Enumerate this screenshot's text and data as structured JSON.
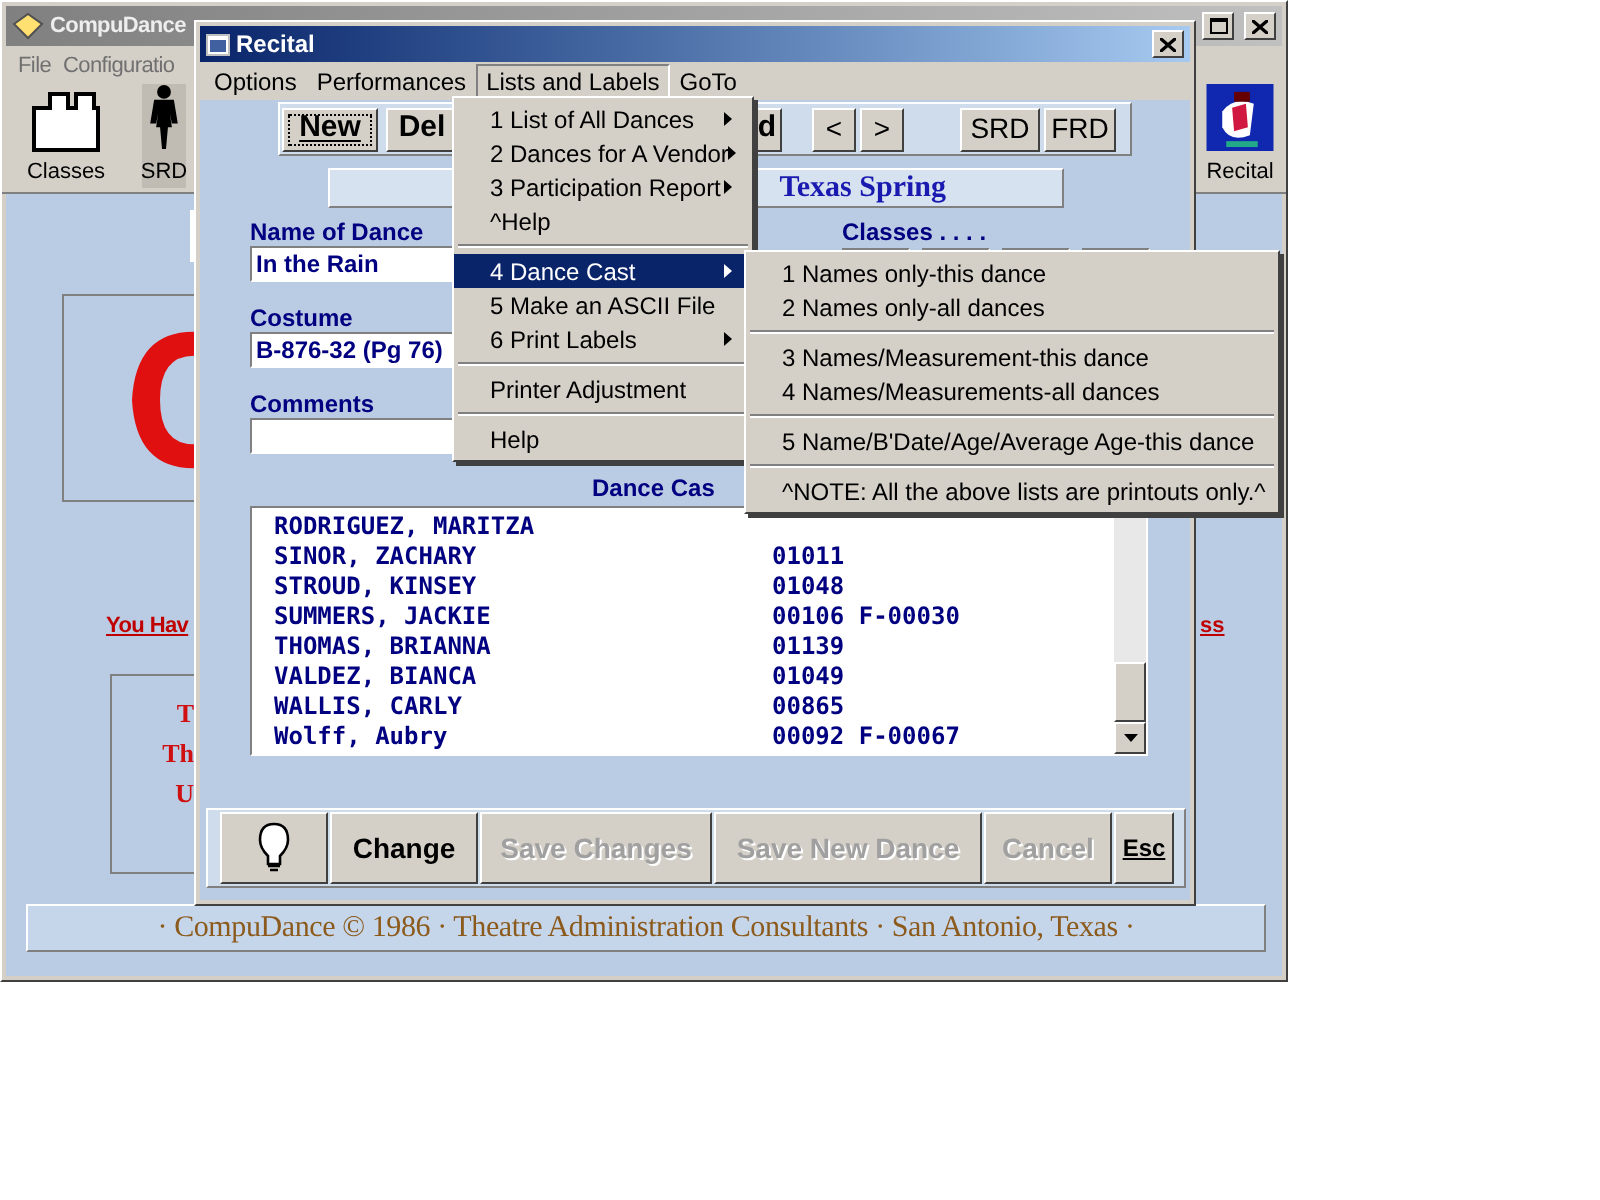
{
  "app_window": {
    "title": "CompuDance",
    "menu": [
      "File",
      "Configuratio"
    ],
    "toolbar": [
      {
        "label": "Classes",
        "kind": "classes"
      },
      {
        "label": "SRD",
        "kind": "figure"
      },
      {
        "label": "Recital",
        "kind": "recital"
      }
    ],
    "notice_left": "You Hav",
    "notice_right": "ss",
    "lines": [
      "T",
      "Th",
      "U"
    ],
    "footer": "· CompuDance © 1986 · Theatre Administration Consultants · San Antonio, Texas ·"
  },
  "recital_window": {
    "title": "Recital",
    "menu": [
      {
        "label": "Options",
        "selected": false
      },
      {
        "label": "Performances",
        "selected": false
      },
      {
        "label": "Lists and Labels",
        "selected": true
      },
      {
        "label": "GoTo",
        "selected": false
      }
    ],
    "toolbar": [
      "New",
      "Del",
      "d",
      "<",
      ">",
      "SRD",
      "FRD"
    ],
    "season": "Texas Spring",
    "classes_label": "Classes . . . .",
    "fields": [
      {
        "label": "Name of Dance",
        "value": "In the Rain"
      },
      {
        "label": "Costume",
        "value": "B-876-32 (Pg 76)"
      },
      {
        "label": "Comments"
      }
    ],
    "cast_label": "Dance Cas",
    "cast": [
      {
        "name": "RODRIGUEZ, MARITZA"
      },
      {
        "name": "SINOR, ZACHARY",
        "number": "01011"
      },
      {
        "name": "STROUD, KINSEY",
        "number": "01048"
      },
      {
        "name": "SUMMERS, JACKIE",
        "number": "00106 F-00030"
      },
      {
        "name": "THOMAS, BRIANNA",
        "number": "01139"
      },
      {
        "name": "VALDEZ, BIANCA",
        "number": "01049"
      },
      {
        "name": "WALLIS, CARLY",
        "number": "00865"
      },
      {
        "name": "Wolff, Aubry",
        "number": "00092 F-00067"
      }
    ],
    "buttons": [
      {
        "label": "Change",
        "disabled": false
      },
      {
        "label": "Save Changes",
        "disabled": true
      },
      {
        "label": "Save New Dance",
        "disabled": true
      },
      {
        "label": "Cancel",
        "disabled": true
      },
      {
        "label": "Esc",
        "disabled": false
      }
    ]
  },
  "lists_menu": [
    {
      "kind": "item",
      "label": "1 List of All Dances",
      "submenu": true,
      "selected": false
    },
    {
      "kind": "item",
      "label": "2 Dances for A Vendor",
      "submenu": true,
      "selected": false
    },
    {
      "kind": "item",
      "label": "3 Participation Report",
      "submenu": true,
      "selected": false
    },
    {
      "kind": "item",
      "label": "^Help",
      "submenu": false,
      "selected": false
    },
    {
      "kind": "separator"
    },
    {
      "kind": "item",
      "label": "4 Dance Cast",
      "submenu": true,
      "selected": true
    },
    {
      "kind": "item",
      "label": "5 Make an ASCII File",
      "submenu": false,
      "selected": false
    },
    {
      "kind": "item",
      "label": "6 Print Labels",
      "submenu": true,
      "selected": false
    },
    {
      "kind": "separator"
    },
    {
      "kind": "item",
      "label": "Printer Adjustment",
      "submenu": false,
      "selected": false
    },
    {
      "kind": "separator"
    },
    {
      "kind": "item",
      "label": "Help",
      "submenu": false,
      "selected": false
    }
  ],
  "cast_submenu": [
    {
      "kind": "item",
      "label": "1 Names only-this dance",
      "selected": false
    },
    {
      "kind": "item",
      "label": "2 Names only-all dances",
      "selected": false
    },
    {
      "kind": "separator"
    },
    {
      "kind": "item",
      "label": "3 Names/Measurement-this dance",
      "selected": false
    },
    {
      "kind": "item",
      "label": "4 Names/Measurements-all dances",
      "selected": false
    },
    {
      "kind": "separator"
    },
    {
      "kind": "item",
      "label": "5 Name/B'Date/Age/Average Age-this dance",
      "selected": false
    },
    {
      "kind": "separator"
    },
    {
      "kind": "item",
      "label": "^NOTE: All the above lists are printouts only.^",
      "selected": false
    }
  ]
}
